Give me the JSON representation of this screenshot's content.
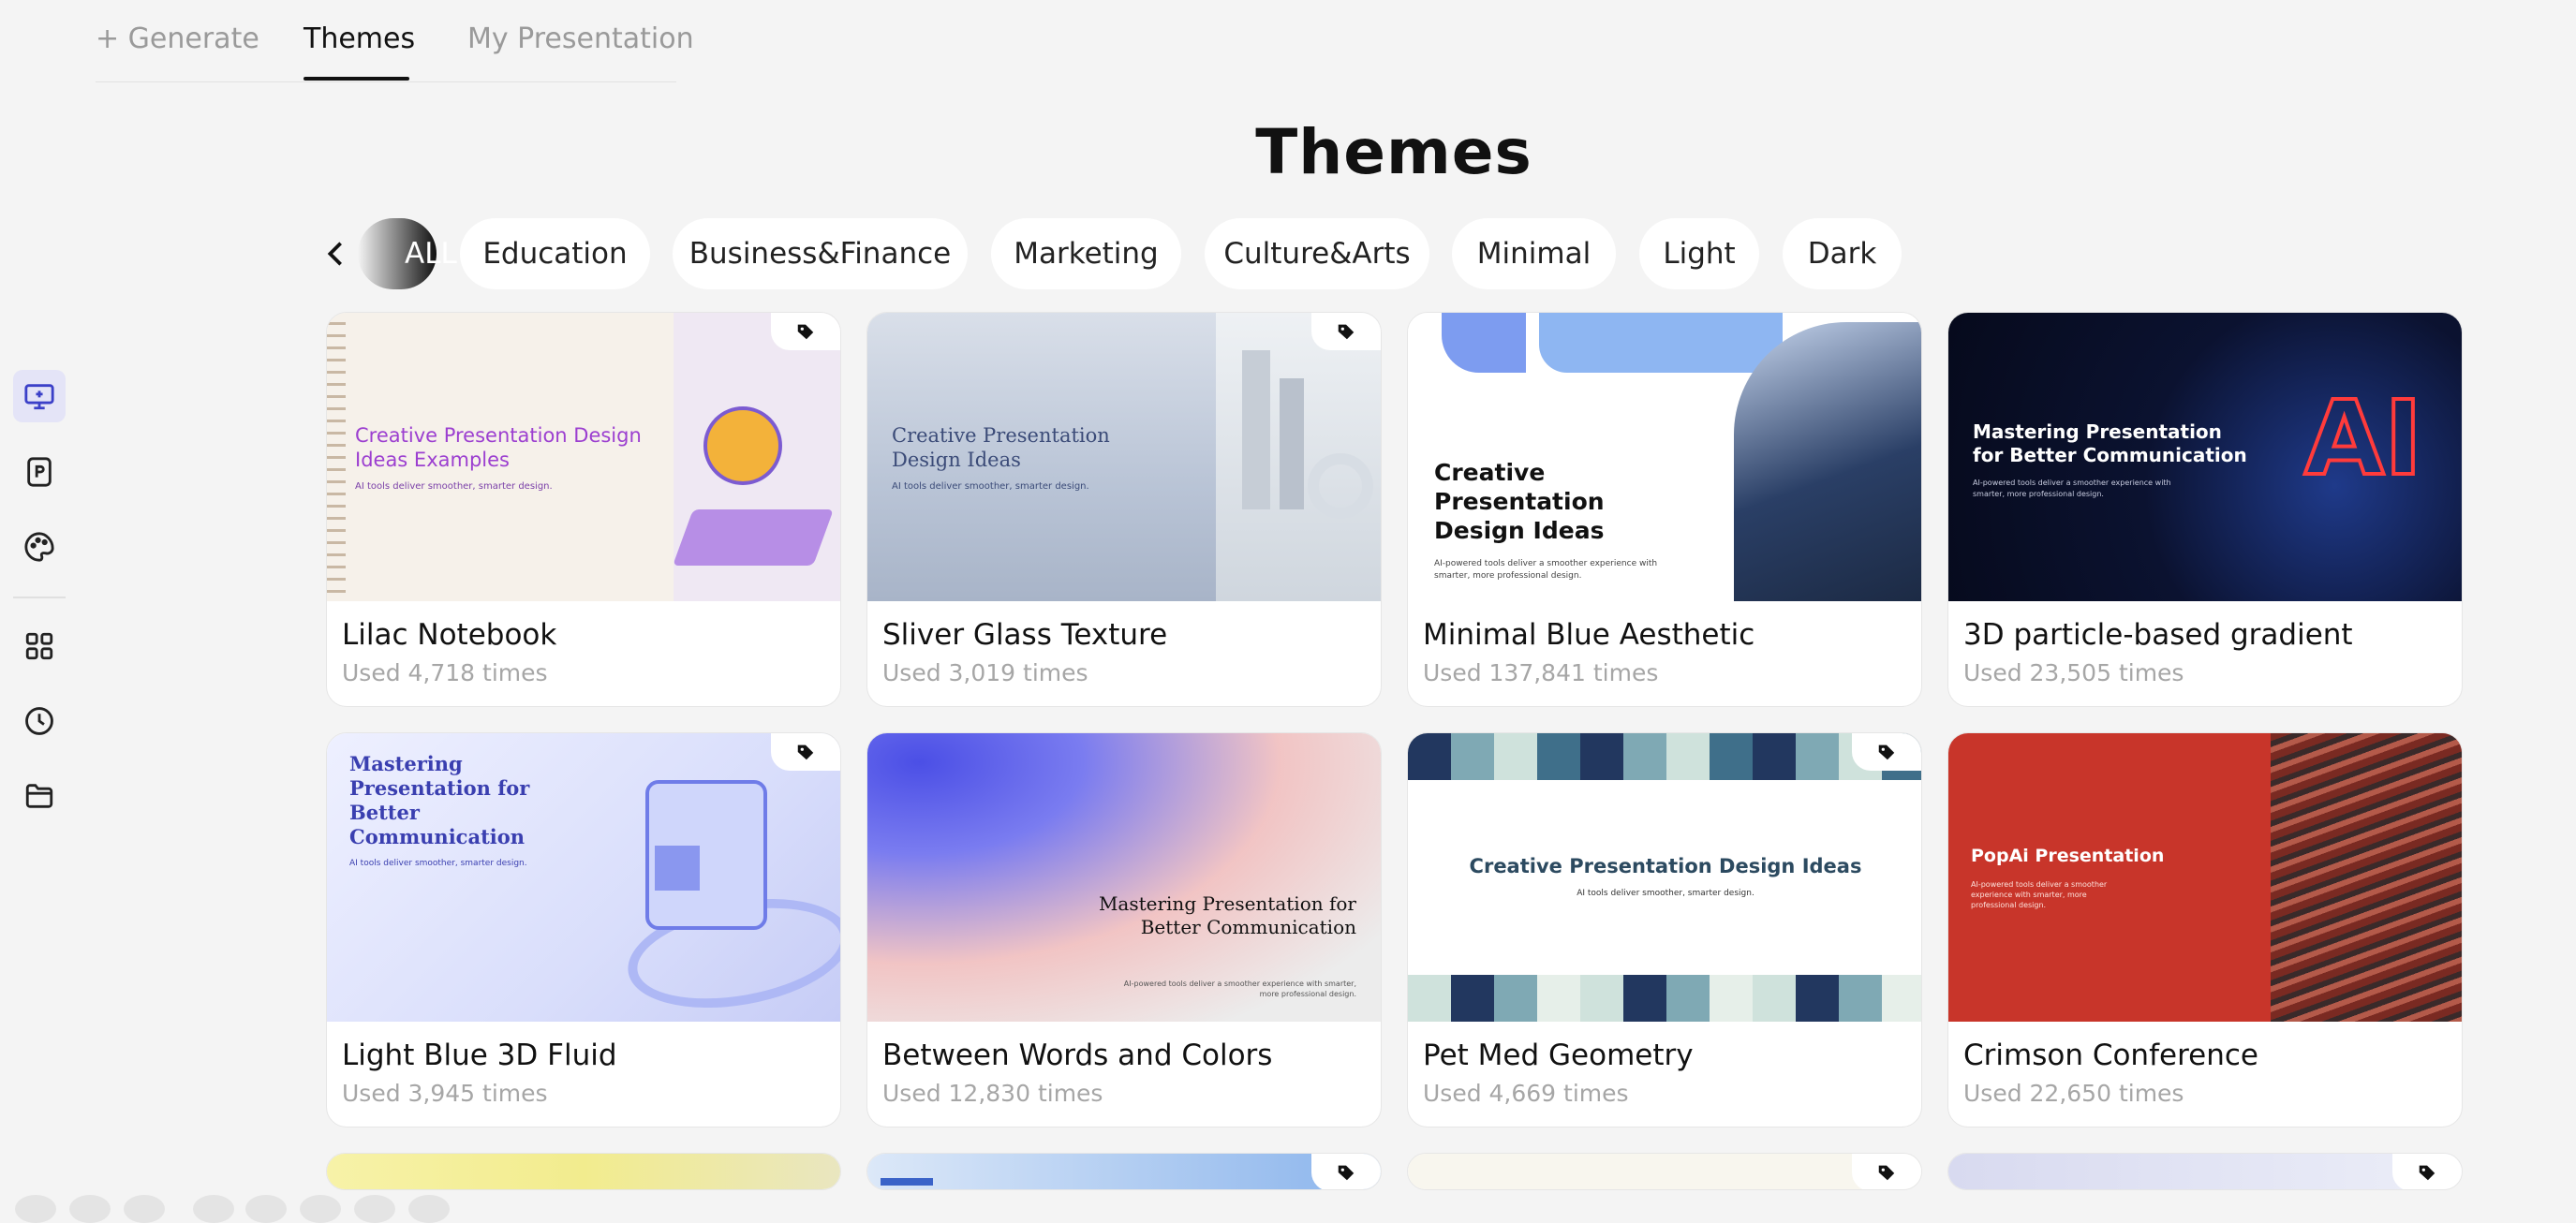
{
  "topnav": {
    "tabs": [
      {
        "label": "+ Generate"
      },
      {
        "label": "Themes"
      },
      {
        "label": "My Presentation"
      }
    ]
  },
  "rail": {
    "icons": [
      "presentation-icon",
      "p-document-icon",
      "palette-icon",
      "grid-icon",
      "clock-icon",
      "folder-icon"
    ]
  },
  "page": {
    "title": "Themes"
  },
  "filters": {
    "items": [
      "ALL",
      "Education",
      "Business&Finance",
      "Marketing",
      "Culture&Arts",
      "Minimal",
      "Light",
      "Dark"
    ],
    "selected": "ALL"
  },
  "colors": {
    "accent": "#111111",
    "rail_active": "#e4e4f7",
    "muted": "#a6a6a6"
  },
  "cards": [
    {
      "name": "Lilac Notebook",
      "uses": "Used 4,718 times",
      "thumb_title": "Creative Presentation Design Ideas Examples",
      "thumb_sub": "AI tools deliver smoother, smarter design."
    },
    {
      "name": "Sliver Glass Texture",
      "uses": "Used 3,019 times",
      "thumb_title": "Creative Presentation Design Ideas",
      "thumb_sub": "AI tools deliver smoother, smarter design."
    },
    {
      "name": "Minimal Blue Aesthetic",
      "uses": "Used 137,841 times",
      "thumb_title": "Creative Presentation Design Ideas",
      "thumb_sub": "AI-powered tools deliver a smoother experience with smarter, more professional design."
    },
    {
      "name": "3D particle-based gradient",
      "uses": "Used 23,505 times",
      "thumb_title": "Mastering Presentation for Better Communication",
      "thumb_sub": "AI-powered tools deliver a smoother experience with smarter, more professional design.",
      "thumb_extra": "AI"
    },
    {
      "name": "Light Blue 3D Fluid",
      "uses": "Used 3,945 times",
      "thumb_title": "Mastering Presentation for Better Communication",
      "thumb_sub": "AI tools deliver smoother, smarter design."
    },
    {
      "name": "Between Words and Colors",
      "uses": "Used 12,830 times",
      "thumb_title": "Mastering Presentation for Better Communication",
      "thumb_sub": "AI-powered tools deliver a smoother experience with smarter, more professional design."
    },
    {
      "name": "Pet Med Geometry",
      "uses": "Used 4,669 times",
      "thumb_title": "Creative Presentation Design Ideas",
      "thumb_sub": "AI tools deliver smoother, smarter design."
    },
    {
      "name": "Crimson Conference",
      "uses": "Used 22,650 times",
      "thumb_title": "PopAi Presentation",
      "thumb_sub": "AI-powered tools deliver a smoother experience with smarter, more professional design."
    }
  ]
}
